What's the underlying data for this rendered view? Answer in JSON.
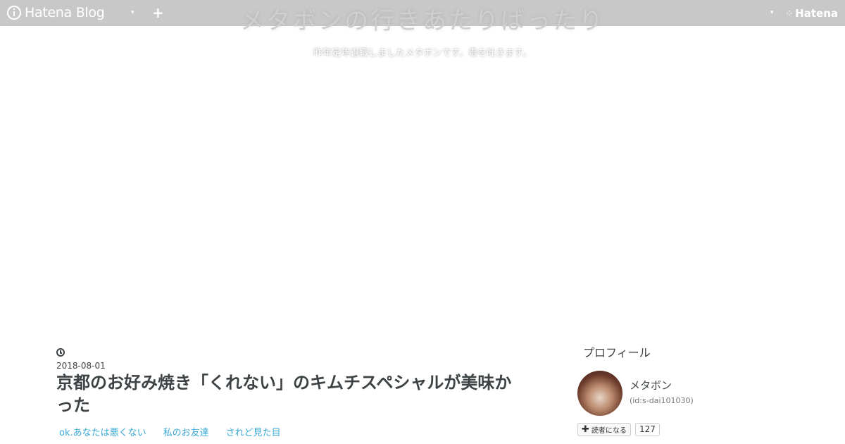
{
  "topbar": {
    "brand": "Hatena Blog",
    "right_brand": "Hatena",
    "plus_label": "+",
    "caret": "▾"
  },
  "blog": {
    "title": "メタボンの行きあたりばったり",
    "description": "昨年定年退職しましたメタボンです。毒を吐きます。"
  },
  "entry": {
    "date": "2018-08-01",
    "title": "京都のお好み焼き「くれない」のキムチスペシャルが美味かった",
    "categories": [
      "ok.あなたは悪くない",
      "私のお友達",
      "されど見た目"
    ]
  },
  "sidebar": {
    "profile_title": "プロフィール",
    "name": "メタボン",
    "user_id": "(id:s-dai101030)",
    "subscribe_label": "読者になる",
    "subscriber_count": "127"
  },
  "colors": {
    "topbar": "#c8c8c8",
    "text": "#3d4245",
    "link": "#3aa9d6"
  },
  "icons": {
    "hatena-blog-logo": "circle-i",
    "clock-icon": "clock",
    "plus-icon": "+"
  }
}
